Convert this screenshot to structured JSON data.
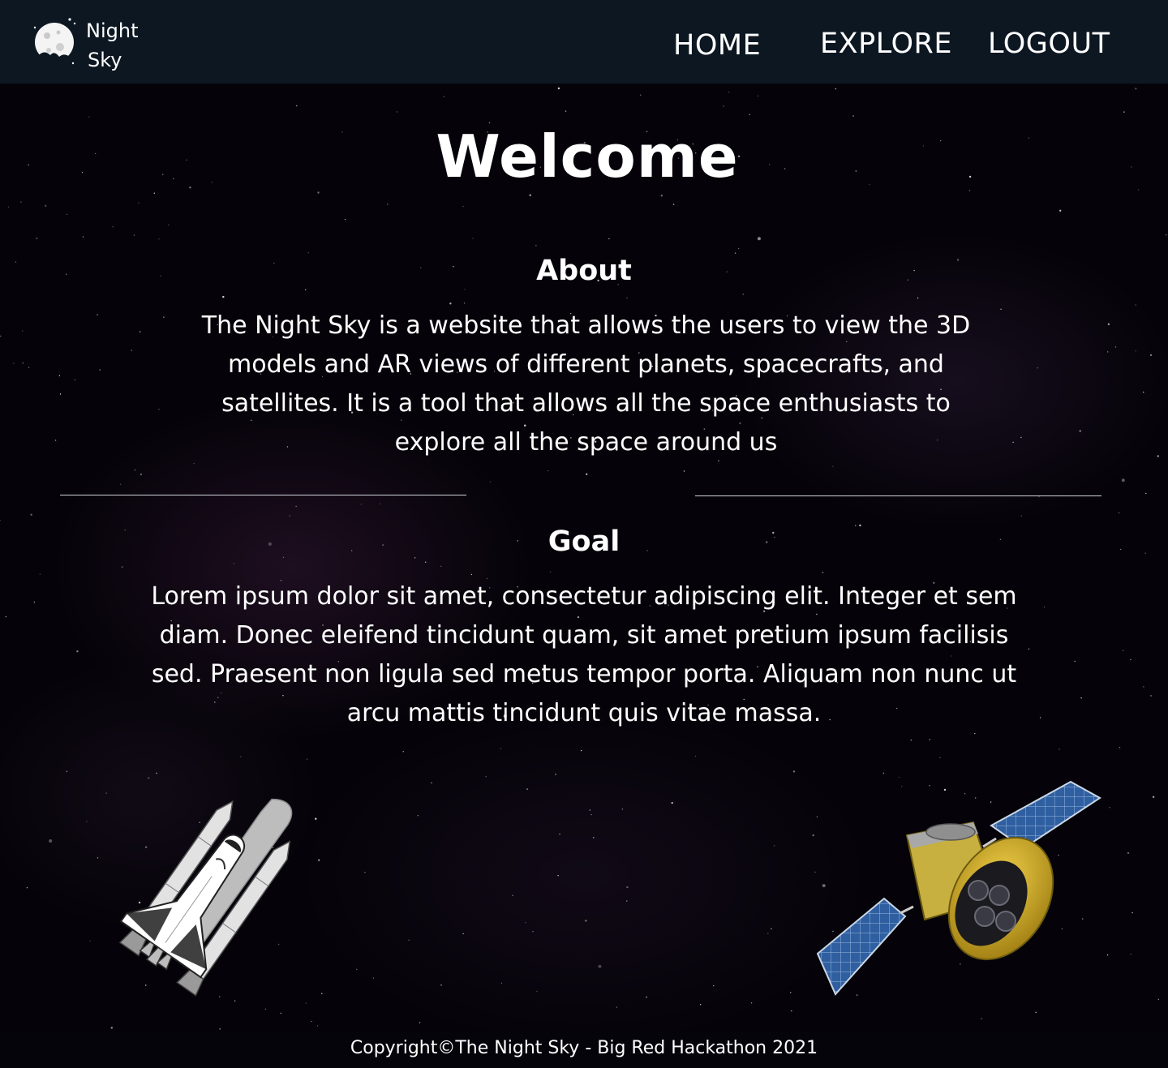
{
  "brand": {
    "name_line1": "Night",
    "name_line2": "Sky",
    "logo_icon": "moon-icon"
  },
  "nav": {
    "items": [
      {
        "label": "HOME",
        "icon": null
      },
      {
        "label": "EXPLORE",
        "icon": null
      },
      {
        "label": "LOGOUT",
        "icon": null
      }
    ]
  },
  "main": {
    "heading": "Welcome",
    "about": {
      "title": "About",
      "body": "The Night Sky is a website that allows the users to view the 3D models and AR views of different planets, spacecrafts, and satellites. It is a tool that allows all the space enthusiasts to explore all the space around us"
    },
    "goal": {
      "title": "Goal",
      "body": "Lorem ipsum dolor sit amet, consectetur adipiscing elit. Integer et sem diam. Donec eleifend tincidunt quam, sit amet pretium ipsum facilisis sed. Praesent non ligula sed metus tempor porta. Aliquam non nunc ut arcu mattis tincidunt quis vitae massa."
    },
    "illustrations": [
      "space-shuttle-icon",
      "satellite-icon"
    ]
  },
  "footer": {
    "copyright": "Copyright©The Night Sky - Big Red Hackathon 2021"
  },
  "colors": {
    "header_bg": "#0c1722",
    "page_bg": "#050309",
    "text": "#ffffff",
    "divider": "#cfd3d8",
    "satellite_gold": "#d4b020",
    "solar_panel": "#2f5fa0"
  }
}
